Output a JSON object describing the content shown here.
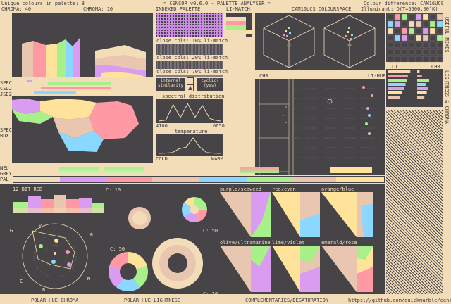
{
  "header": {
    "unique_colours": "Unique colours in palette: 8",
    "chroma_a": "CHROMA: 40",
    "chroma_b": "CHROMA: 10",
    "title": "= CENSOR v0.6.0 - PALETTE ANALYSER =",
    "colour_difference": "Colour difference: CAM16UCS",
    "illuminant": "Illuminant: D(T=5500.00°K)"
  },
  "labels": {
    "indexed_palette": "INDEXED PALETTE",
    "li_match": "LI-MATCH",
    "cam16_colourspace": "CAM16UCS COLOURSPACE",
    "close_cols_a": "close cols: 10% li-match",
    "close_cols_b": "close cols: 20% li-match",
    "close_cols_c": "close cols: 70% li-match",
    "internal_similarity": "internal similarity",
    "cyclic": "cyclic?",
    "yes": "(yes)",
    "spectral_distribution": "spectral distribution",
    "spec_min": "4100",
    "spec_max": "6650",
    "temperature": "temperature",
    "cold": "COLD",
    "warm": "WARM",
    "chr": "CHR",
    "li_hue": "LI-HUE",
    "li": "LI",
    "chr2": "CHR",
    "spec": "SPEC",
    "csd2": "CSD2",
    "jsd2": "JSD2",
    "spec2": "SPEC",
    "bdx": "BDX",
    "neu": "NEU",
    "grey": "GREY",
    "pal": "PAL",
    "twelve_bit": "12 BIT RGB",
    "c10a": "C: 10",
    "c50a": "C: 50",
    "c50b": "C: 50",
    "c10b": "C: 10",
    "purple_seaweed": "purple/seaweed",
    "red_cyan": "red/cyan",
    "orange_blue": "orange/blue",
    "olive_ultramarine": "olive/ultramarine",
    "lime_violet": "lime/violet",
    "emerald_rose": "emerald/rose",
    "polar_hue_chroma": "POLAR HUE-CHROMA",
    "polar_hue_lightness": "POLAR HUE-LIGHTNESS",
    "complementaries": "COMPLEMENTARIES/DESATURATION",
    "github": "https://github.com/quickmarble/censor",
    "useful_mixes": "USEFUL MIXES",
    "lightness_chroma": "LIGHTNESS & CHROMA",
    "axis_g": "G",
    "axis_y": "Y",
    "axis_r": "R",
    "axis_c": "C",
    "axis_b": "B",
    "axis_m": "M"
  },
  "palette": {
    "colors": [
      "#474448",
      "#f3dcb8",
      "#ff9aa4",
      "#a8f08a",
      "#8ad8ff",
      "#d99cf0",
      "#ffe39a",
      "#e9c6b0"
    ]
  },
  "colors": {
    "background": "#f3dcb8",
    "panel": "#474448",
    "pink": "#ff9aa4",
    "green": "#a8f08a",
    "blue": "#8ad8ff",
    "violet": "#d99cf0",
    "yellow": "#ffe39a",
    "tan": "#e9c6b0"
  },
  "chart_data": [
    {
      "type": "line",
      "title": "spectral distribution",
      "x": [
        4100,
        4400,
        4700,
        5000,
        5300,
        5600,
        5900,
        6200,
        6400,
        6650
      ],
      "series": [
        {
          "values": [
            0,
            0.05,
            0.9,
            0.2,
            0.95,
            0.2,
            0.85,
            0.15,
            0.05,
            0
          ]
        }
      ],
      "xlim": [
        4100,
        6650
      ]
    },
    {
      "type": "line",
      "title": "temperature",
      "x": [
        0,
        1,
        2,
        3,
        4,
        5,
        6,
        7,
        8,
        9
      ],
      "series": [
        {
          "values": [
            0,
            0.02,
            0.05,
            0.3,
            0.4,
            1.0,
            0.4,
            0.05,
            0.02,
            0
          ]
        }
      ]
    }
  ]
}
